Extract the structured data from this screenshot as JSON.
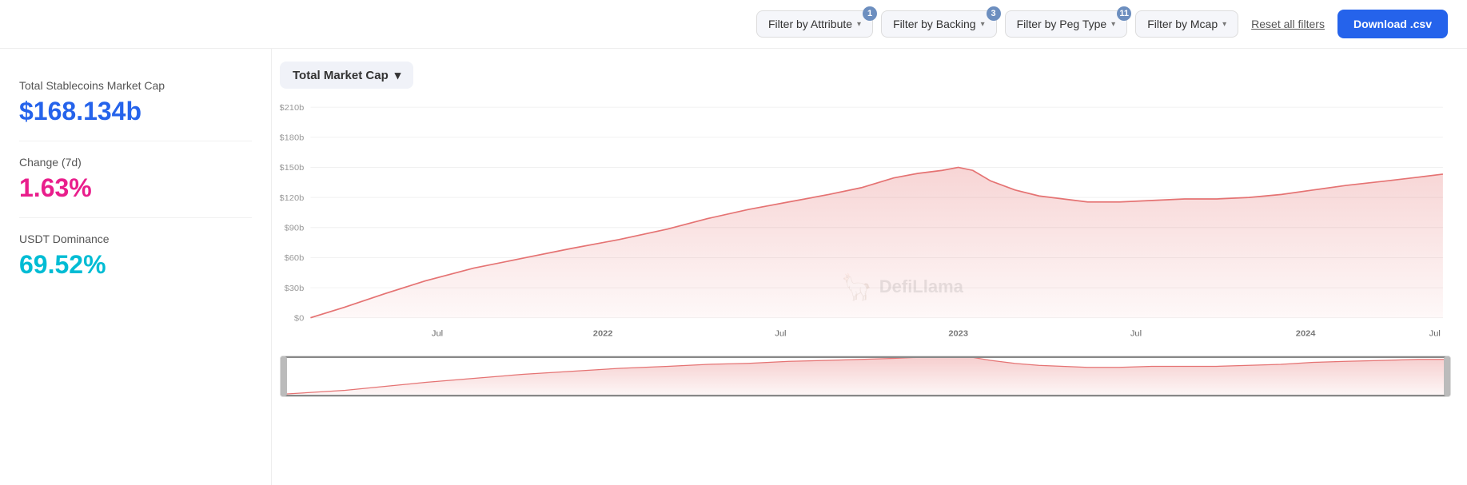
{
  "topbar": {
    "filters": [
      {
        "label": "Filter by Attribute",
        "badge": 1
      },
      {
        "label": "Filter by Backing",
        "badge": 3
      },
      {
        "label": "Filter by Peg Type",
        "badge": 11
      },
      {
        "label": "Filter by Mcap",
        "badge": null
      }
    ],
    "reset_label": "Reset all filters",
    "download_label": "Download .csv"
  },
  "sidebar": {
    "stats": [
      {
        "label": "Total Stablecoins Market Cap",
        "value": "$168.134b",
        "color_class": "stat-value-blue"
      },
      {
        "label": "Change (7d)",
        "value": "1.63%",
        "color_class": "stat-value-pink"
      },
      {
        "label": "USDT Dominance",
        "value": "69.52%",
        "color_class": "stat-value-teal"
      }
    ]
  },
  "chart": {
    "selector_label": "Total Market Cap",
    "y_labels": [
      "$210b",
      "$180b",
      "$150b",
      "$120b",
      "$90b",
      "$60b",
      "$30b",
      "$0"
    ],
    "x_labels": [
      "Jul",
      "2022",
      "Jul",
      "2023",
      "Jul",
      "2024",
      "Jul"
    ],
    "watermark": "DefiLlama"
  }
}
